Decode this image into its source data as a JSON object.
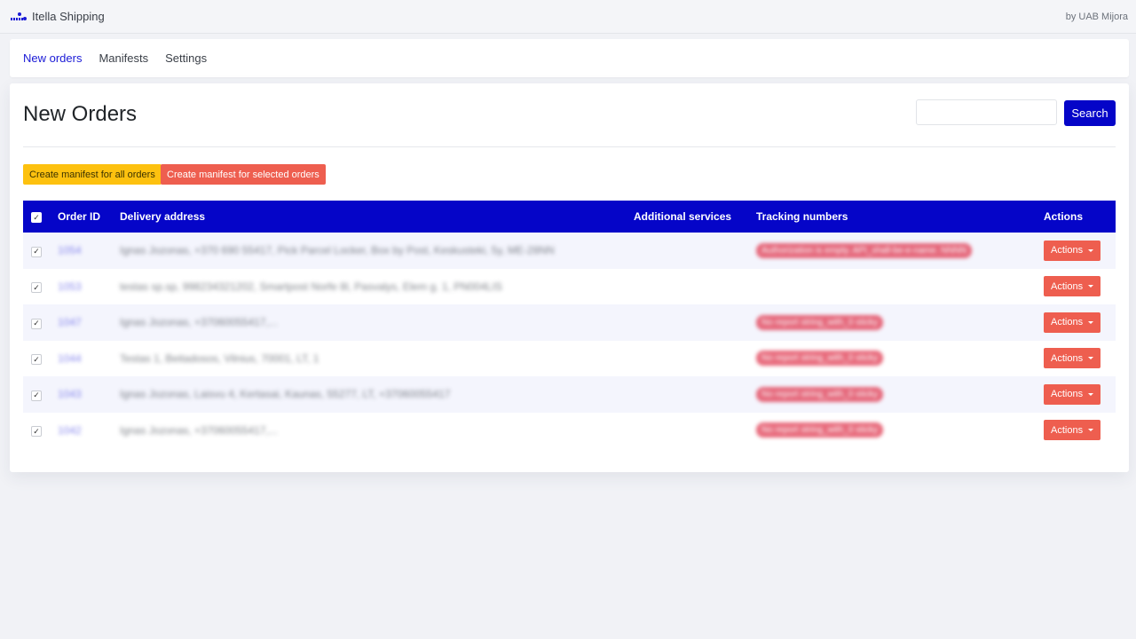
{
  "app": {
    "title": "Itella Shipping",
    "vendor": "by UAB Mijora",
    "logo_icon": "itella-logo-icon"
  },
  "nav": {
    "items": [
      {
        "label": "New orders",
        "active": true
      },
      {
        "label": "Manifests",
        "active": false
      },
      {
        "label": "Settings",
        "active": false
      }
    ]
  },
  "page": {
    "title": "New Orders",
    "search": {
      "value": "",
      "placeholder": "",
      "button_label": "Search"
    },
    "buttons": {
      "create_all": "Create manifest for all orders",
      "create_selected": "Create manifest for selected orders"
    }
  },
  "table": {
    "headers": {
      "select_all_checked": true,
      "order_id": "Order ID",
      "delivery_address": "Delivery address",
      "additional_services": "Additional services",
      "tracking_numbers": "Tracking numbers",
      "actions": "Actions"
    },
    "rows": [
      {
        "checked": true,
        "order_id": "1054",
        "address": "Ignas Jozonas, +370 690 55417, Pick Parcel Locker, Box by Post, Keskusteki, 5y, ME-28NN",
        "services": "",
        "tracking": "Authorization is empty. API_shall-be-e-name. NNNN",
        "action_label": "Actions"
      },
      {
        "checked": true,
        "order_id": "1053",
        "address": "testas sp.sp, 998234321202, Smartpost Norfe 8l, Pasvalys, Elem g. 1, PN004LIS",
        "services": "",
        "tracking": "",
        "action_label": "Actions"
      },
      {
        "checked": true,
        "order_id": "1047",
        "address": "Ignas Jozonas, +37060055417,...",
        "services": "",
        "tracking": "No report string_with_0 sticky",
        "action_label": "Actions"
      },
      {
        "checked": true,
        "order_id": "1044",
        "address": "Testas 1, Beitadosos, Vilnius, 70001, LT, 1",
        "services": "",
        "tracking": "No report string_with_0 sticky",
        "action_label": "Actions"
      },
      {
        "checked": true,
        "order_id": "1043",
        "address": "Ignas Jozonas, Laisvu 4, Kertasai, Kaunas, 55277, LT, +37060055417",
        "services": "",
        "tracking": "No report string_with_0 sticky",
        "action_label": "Actions"
      },
      {
        "checked": true,
        "order_id": "1042",
        "address": "Ignas Jozonas, +37060055417,...",
        "services": "",
        "tracking": "No report string_with_0 sticky",
        "action_label": "Actions"
      }
    ]
  },
  "colors": {
    "primary": "#0505c8",
    "warning": "#fdc10f",
    "danger": "#ee5e4f",
    "badge": "#e2445a",
    "background": "#f1f2f6"
  }
}
